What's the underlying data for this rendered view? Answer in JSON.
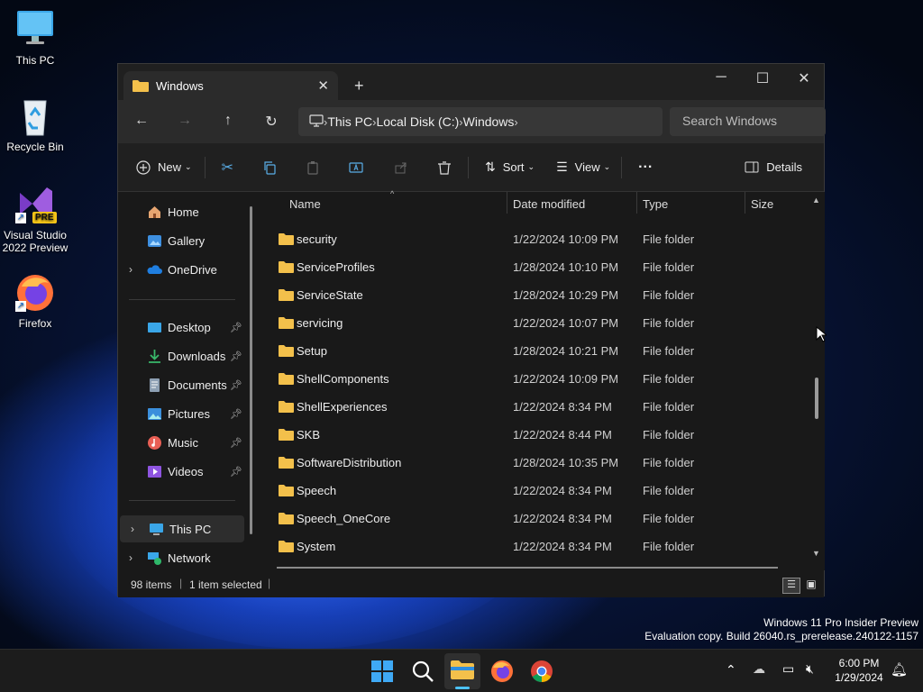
{
  "desktop": {
    "icons": [
      {
        "label": "This PC"
      },
      {
        "label": "Recycle Bin"
      },
      {
        "label": "Visual Studio 2022 Preview"
      },
      {
        "label": "Firefox"
      }
    ],
    "vs_badge": "PRE",
    "watermark": {
      "line1": "Windows 11 Pro Insider Preview",
      "line2": "Evaluation copy. Build 26040.rs_prerelease.240122-1157"
    }
  },
  "window": {
    "tab_title": "Windows",
    "new_tab": "+",
    "close_tab": "✕",
    "address": [
      "This PC",
      "Local Disk (C:)",
      "Windows"
    ],
    "search_placeholder": "Search Windows",
    "toolbar": {
      "new": "New",
      "sort": "Sort",
      "view": "View",
      "more": "···",
      "details": "Details"
    },
    "nav": {
      "home": "Home",
      "gallery": "Gallery",
      "onedrive": "OneDrive",
      "desktop": "Desktop",
      "downloads": "Downloads",
      "documents": "Documents",
      "pictures": "Pictures",
      "music": "Music",
      "videos": "Videos",
      "thispc": "This PC",
      "network": "Network"
    },
    "columns": {
      "name": "Name",
      "date": "Date modified",
      "type": "Type",
      "size": "Size"
    },
    "files": [
      {
        "name": "security",
        "date": "1/22/2024 10:09 PM",
        "type": "File folder"
      },
      {
        "name": "ServiceProfiles",
        "date": "1/28/2024 10:10 PM",
        "type": "File folder"
      },
      {
        "name": "ServiceState",
        "date": "1/28/2024 10:29 PM",
        "type": "File folder"
      },
      {
        "name": "servicing",
        "date": "1/22/2024 10:07 PM",
        "type": "File folder"
      },
      {
        "name": "Setup",
        "date": "1/28/2024 10:21 PM",
        "type": "File folder"
      },
      {
        "name": "ShellComponents",
        "date": "1/22/2024 10:09 PM",
        "type": "File folder"
      },
      {
        "name": "ShellExperiences",
        "date": "1/22/2024 8:34 PM",
        "type": "File folder"
      },
      {
        "name": "SKB",
        "date": "1/22/2024 8:44 PM",
        "type": "File folder"
      },
      {
        "name": "SoftwareDistribution",
        "date": "1/28/2024 10:35 PM",
        "type": "File folder"
      },
      {
        "name": "Speech",
        "date": "1/22/2024 8:34 PM",
        "type": "File folder"
      },
      {
        "name": "Speech_OneCore",
        "date": "1/22/2024 8:34 PM",
        "type": "File folder"
      },
      {
        "name": "System",
        "date": "1/22/2024 8:34 PM",
        "type": "File folder"
      }
    ],
    "status": {
      "count": "98 items",
      "selected": "1 item selected"
    }
  },
  "taskbar": {
    "time": "6:00 PM",
    "date": "1/29/2024"
  },
  "colors": {
    "accent": "#4cc2ff",
    "folder": "#f3c04b"
  }
}
